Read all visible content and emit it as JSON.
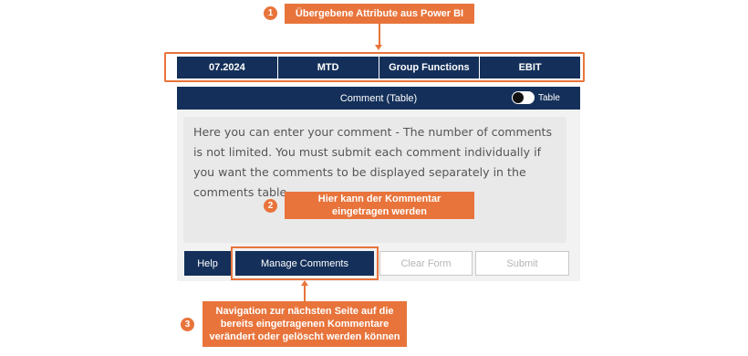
{
  "callouts": [
    {
      "number": "1",
      "text": "Übergebene Attribute aus Power BI"
    },
    {
      "number": "2",
      "text": "Hier kann der Kommentar eingetragen werden"
    },
    {
      "number": "3",
      "text": "Navigation zur nächsten Seite auf die bereits eingetragenen Kommentare verändert oder gelöscht werden können"
    }
  ],
  "attributes": [
    "07.2024",
    "MTD",
    "Group Functions",
    "EBIT"
  ],
  "header": {
    "title": "Comment (Table)",
    "toggle_label": "Table",
    "toggle_state": "off"
  },
  "comment": {
    "placeholder": "Here you can enter your comment - The number of comments is not limited. You must submit each comment individually if you want the comments to be displayed separately in the comments table."
  },
  "buttons": {
    "help": "Help",
    "manage": "Manage Comments",
    "clear": "Clear Form",
    "submit": "Submit"
  },
  "colors": {
    "accent": "#e8743b",
    "navy": "#14305a",
    "panel": "#f2f2f2"
  }
}
